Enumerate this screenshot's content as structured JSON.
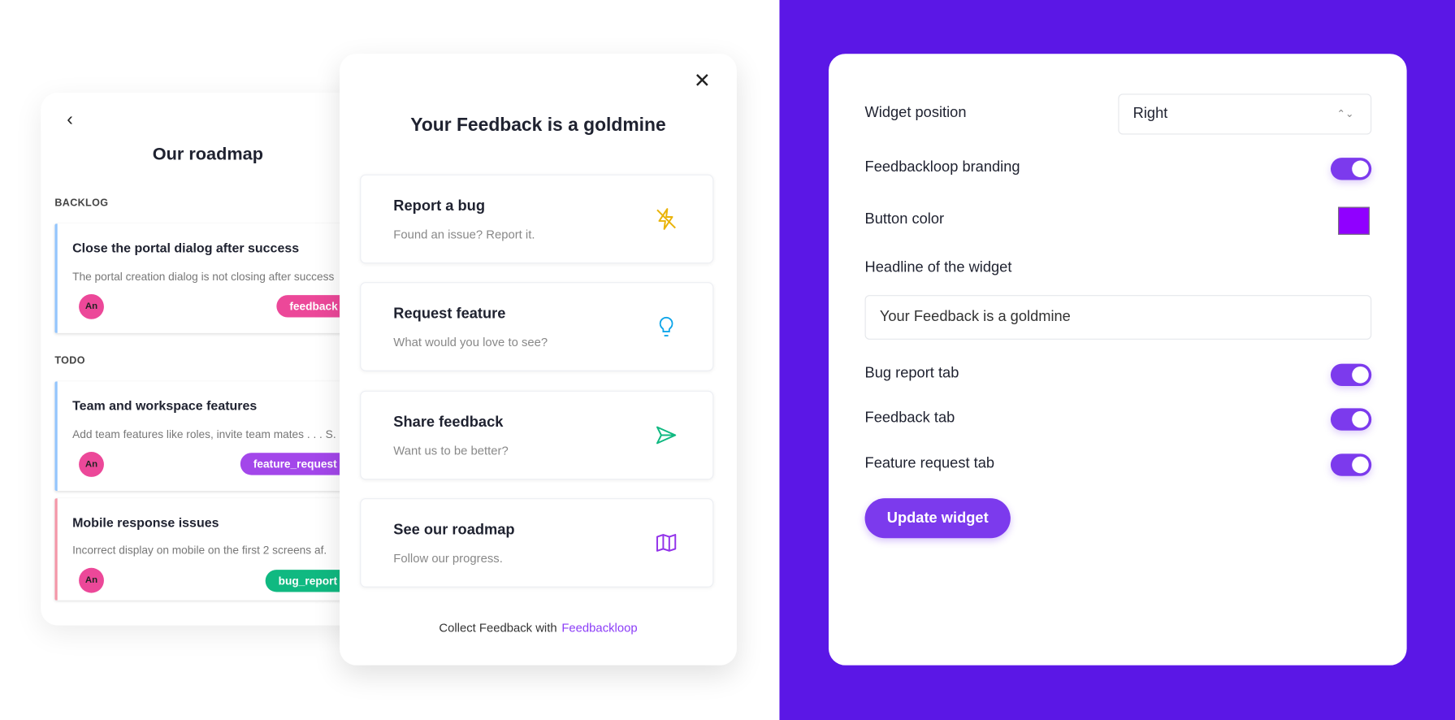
{
  "colors": {
    "background_accent": "#5b17e6",
    "toggle_on": "#7c3aed",
    "button_color": "#9000ff"
  },
  "roadmap": {
    "title": "Our roadmap",
    "back_icon": "chevron-left-icon",
    "sections": [
      {
        "label": "BACKLOG",
        "items": [
          {
            "title": "Close the portal dialog after success",
            "description": "The portal creation dialog is not closing after success",
            "avatar": "An",
            "tag": "feedback",
            "tag_color": "#ec4899",
            "border_color": "#93c5fd"
          }
        ]
      },
      {
        "label": "TODO",
        "items": [
          {
            "title": "Team and workspace features",
            "description": "Add team features like roles, invite team mates . . . S.",
            "avatar": "An",
            "tag": "feature_request",
            "tag_color": "#a347ea",
            "border_color": "#93c5fd"
          },
          {
            "title": "Mobile response issues",
            "description": "Incorrect display on mobile on the first 2 screens af.",
            "avatar": "An",
            "tag": "bug_report",
            "tag_color": "#10b981",
            "border_color": "#f497a8"
          }
        ]
      }
    ]
  },
  "widget": {
    "title": "Your Feedback is a goldmine",
    "close_icon": "close-icon",
    "options": [
      {
        "title": "Report a bug",
        "subtitle": "Found an issue? Report it.",
        "icon": "lightning-icon"
      },
      {
        "title": "Request feature",
        "subtitle": "What would you love to see?",
        "icon": "lightbulb-icon"
      },
      {
        "title": "Share feedback",
        "subtitle": "Want us to be better?",
        "icon": "send-icon"
      },
      {
        "title": "See our roadmap",
        "subtitle": "Follow our progress.",
        "icon": "map-icon"
      }
    ],
    "footer_text": "Collect Feedback with",
    "footer_brand": "Feedbackloop"
  },
  "settings": {
    "widget_position_label": "Widget position",
    "widget_position_value": "Right",
    "branding_label": "Feedbackloop branding",
    "branding_on": true,
    "button_color_label": "Button color",
    "headline_label": "Headline of the widget",
    "headline_value": "Your Feedback is a goldmine",
    "bug_tab_label": "Bug report tab",
    "bug_tab_on": true,
    "feedback_tab_label": "Feedback tab",
    "feedback_tab_on": true,
    "feature_tab_label": "Feature request tab",
    "feature_tab_on": true,
    "update_button": "Update widget"
  }
}
